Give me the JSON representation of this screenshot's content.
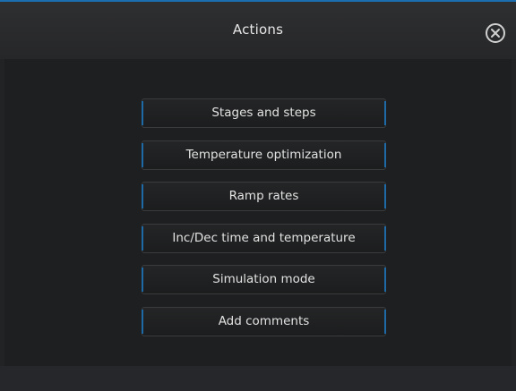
{
  "dialog": {
    "title": "Actions",
    "close_icon": "close-circle-icon"
  },
  "actions": [
    {
      "label": "Stages and steps"
    },
    {
      "label": "Temperature optimization"
    },
    {
      "label": "Ramp rates"
    },
    {
      "label": "Inc/Dec time and temperature"
    },
    {
      "label": "Simulation mode"
    },
    {
      "label": "Add comments"
    }
  ],
  "colors": {
    "accent": "#1b6fb0",
    "background": "#1e1f20",
    "text": "#e2e2e2"
  }
}
